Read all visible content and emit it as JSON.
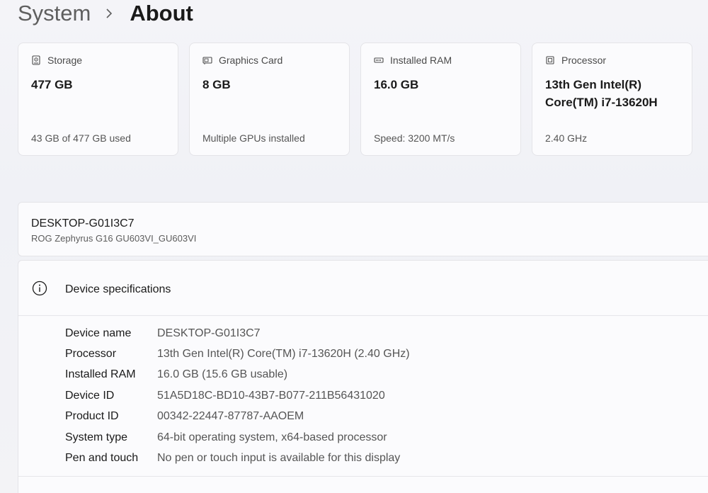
{
  "breadcrumb": {
    "parent": "System",
    "current": "About"
  },
  "cards": [
    {
      "icon": "storage-icon",
      "label": "Storage",
      "value": "477 GB",
      "sub": "43 GB of 477 GB used"
    },
    {
      "icon": "graphics-card-icon",
      "label": "Graphics Card",
      "value": "8 GB",
      "sub": "Multiple GPUs installed"
    },
    {
      "icon": "ram-icon",
      "label": "Installed RAM",
      "value": "16.0 GB",
      "sub": "Speed: 3200 MT/s"
    },
    {
      "icon": "processor-icon",
      "label": "Processor",
      "value": "13th Gen Intel(R) Core(TM) i7-13620H",
      "sub": "2.40 GHz"
    }
  ],
  "device": {
    "name": "DESKTOP-G01I3C7",
    "model": "ROG Zephyrus G16 GU603VI_GU603VI"
  },
  "specs": {
    "title": "Device specifications",
    "rows": [
      {
        "label": "Device name",
        "value": "DESKTOP-G01I3C7"
      },
      {
        "label": "Processor",
        "value": "13th Gen Intel(R) Core(TM) i7-13620H (2.40 GHz)"
      },
      {
        "label": "Installed RAM",
        "value": "16.0 GB (15.6 GB usable)"
      },
      {
        "label": "Device ID",
        "value": "51A5D18C-BD10-43B7-B077-211B56431020"
      },
      {
        "label": "Product ID",
        "value": "00342-22447-87787-AAOEM"
      },
      {
        "label": "System type",
        "value": "64-bit operating system, x64-based processor"
      },
      {
        "label": "Pen and touch",
        "value": "No pen or touch input is available for this display"
      }
    ]
  }
}
